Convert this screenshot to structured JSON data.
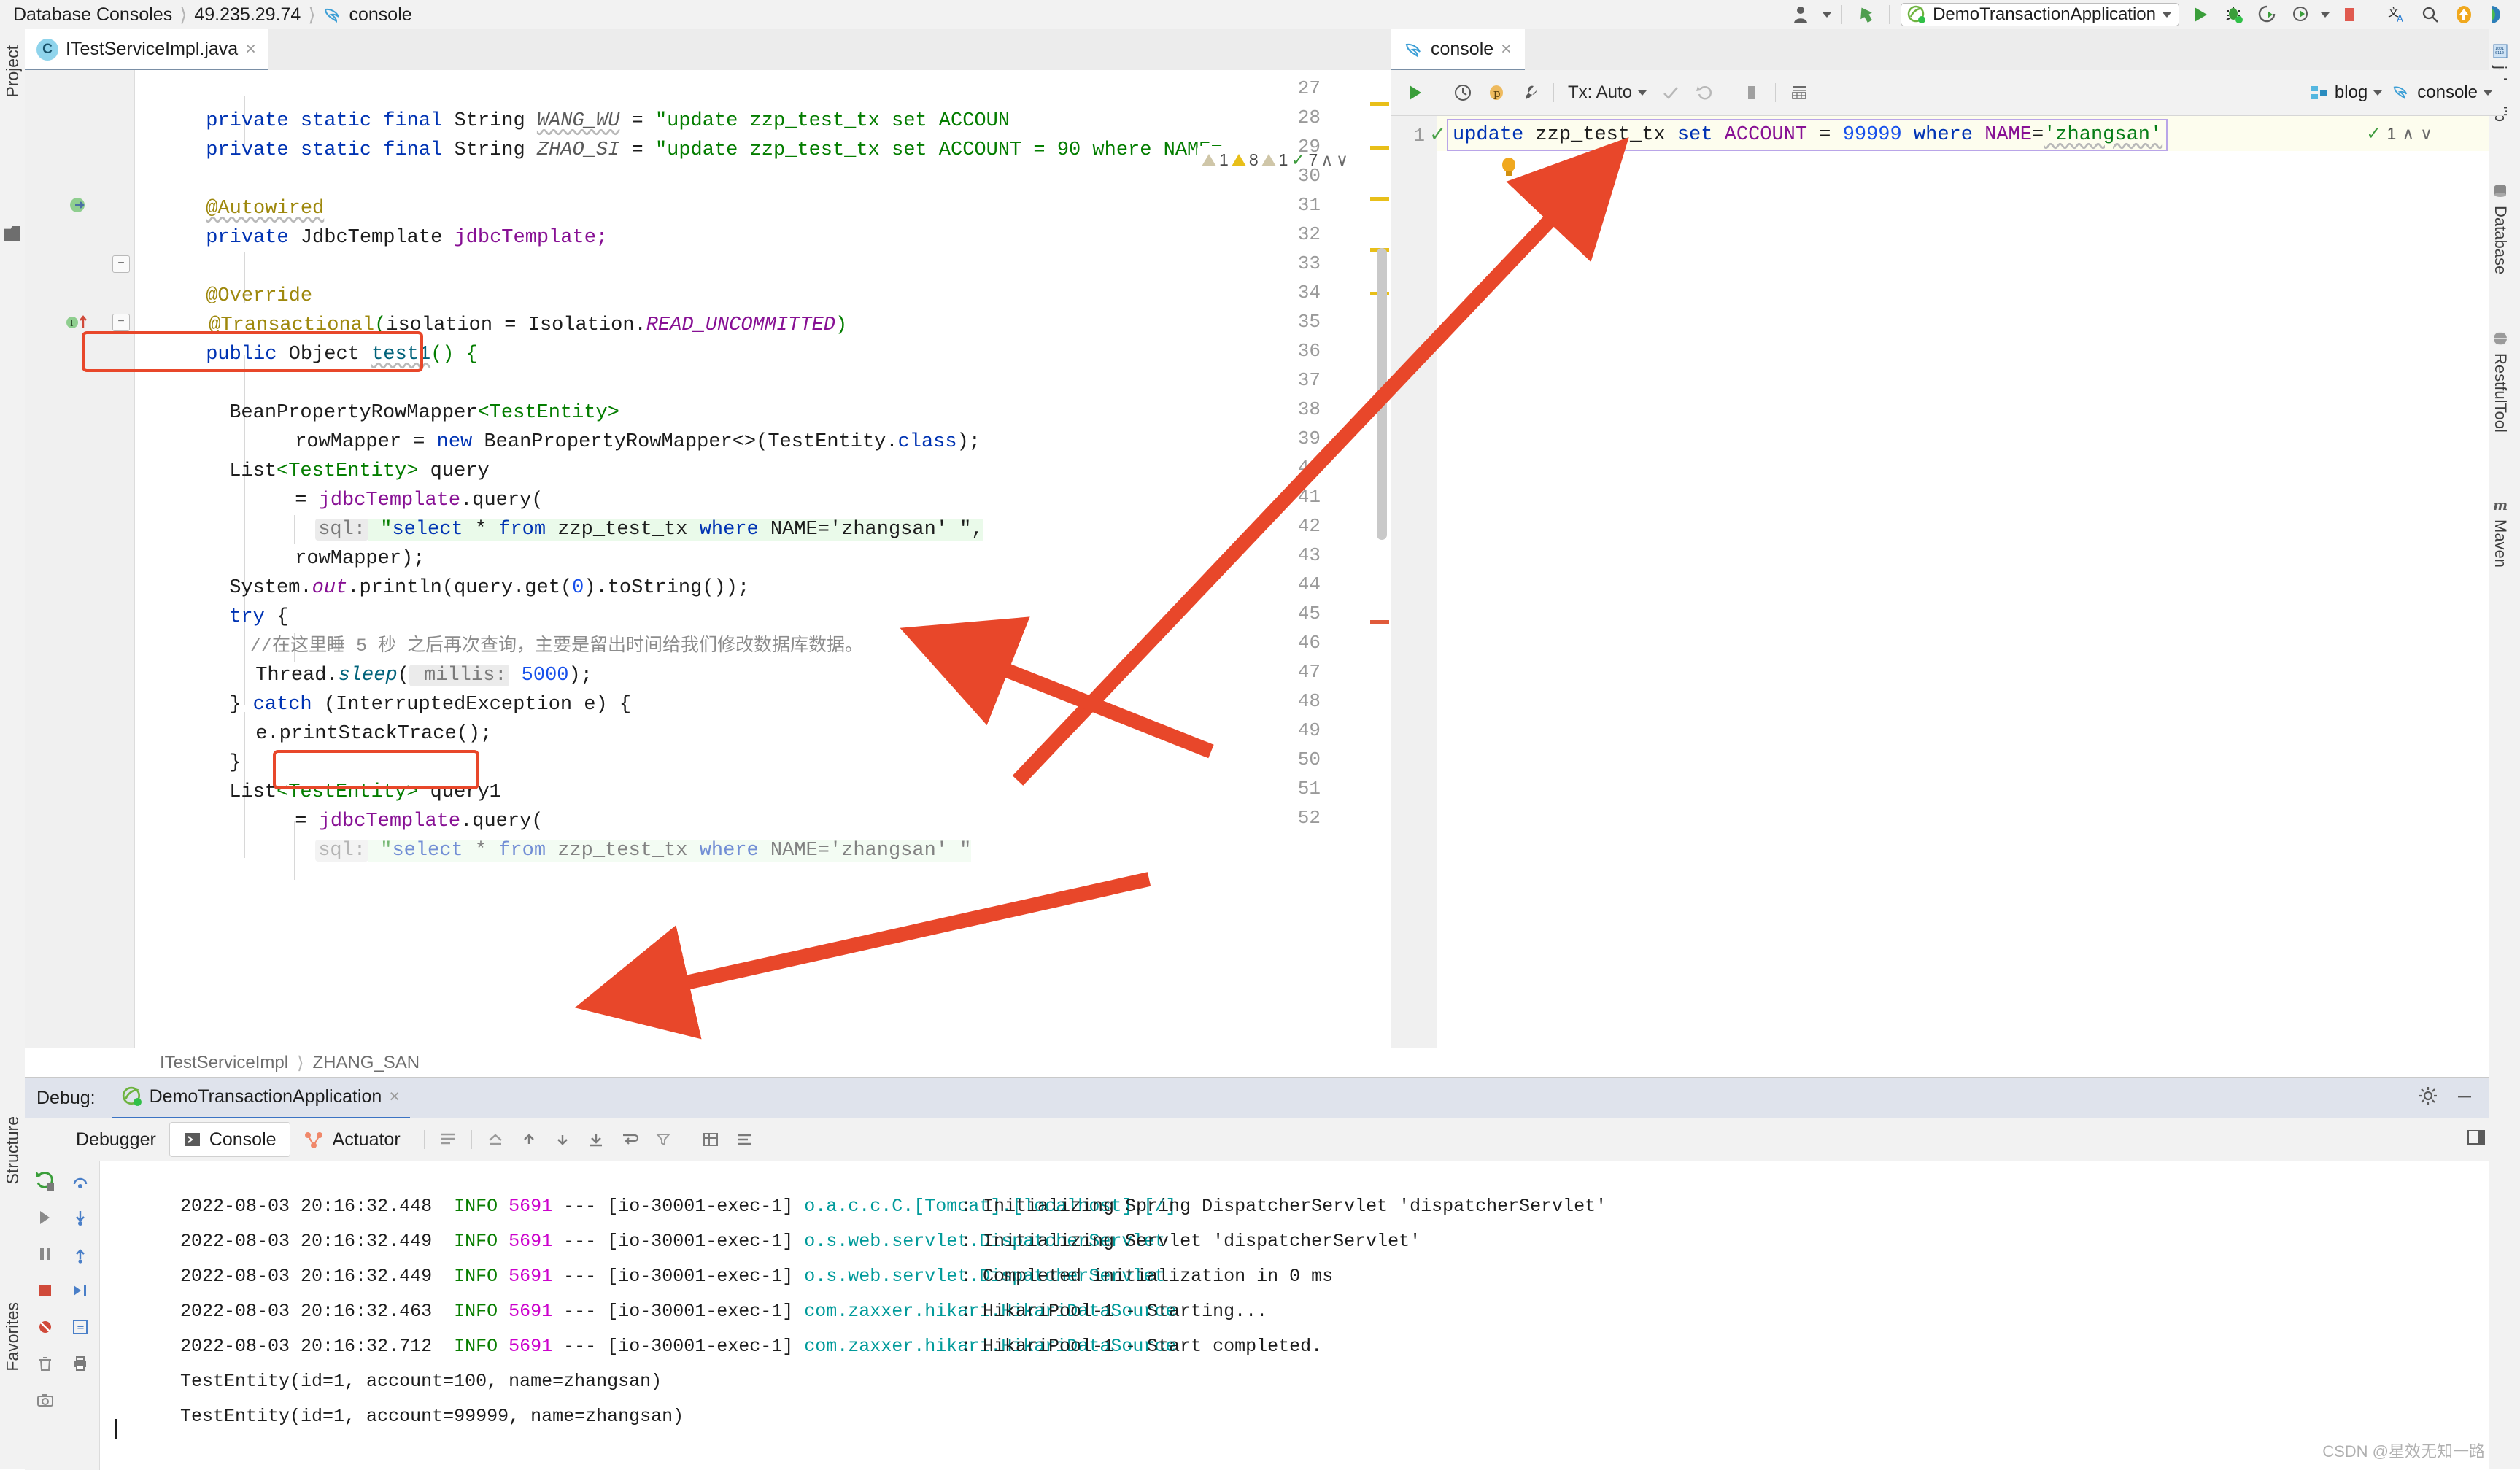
{
  "topbar": {
    "breadcrumbs": [
      "Database Consoles",
      "49.235.29.74",
      "console"
    ],
    "db_icon": "dolphin-icon",
    "right_icons": [
      "user-icon",
      "chevron-down-icon",
      "vcs-update-icon"
    ],
    "run_config": {
      "name": "DemoTransactionApplication",
      "icon": "spring-boot-icon"
    },
    "action_icons": [
      "run-icon",
      "debug-icon",
      "run-with-coverage-icon",
      "profile-icon",
      "stop-icon",
      "translate-icon",
      "search-everywhere-icon",
      "update-icon",
      "theme-icon"
    ]
  },
  "left_strip": {
    "project_label": "Project",
    "structure_label": "Structure",
    "favorites_label": "Favorites",
    "folder_icon": "folder-icon"
  },
  "right_strip": {
    "items": [
      {
        "label": "jclasslib",
        "icon": "jclasslib-icon"
      },
      {
        "label": "Database",
        "icon": "database-icon"
      },
      {
        "label": "RestfulTool",
        "icon": "globe-icon"
      },
      {
        "label": "Maven",
        "icon": "maven-icon"
      }
    ]
  },
  "editor": {
    "tab": {
      "label": "ITestServiceImpl.java",
      "badge": "C",
      "close": "×"
    },
    "inspections": {
      "weak_warning": "1",
      "warning": "8",
      "typo": "1",
      "ok": "7",
      "up": "∧",
      "down": "∨"
    },
    "breadcrumb": [
      "ITestServiceImpl",
      "ZHANG_SAN"
    ],
    "lines": [
      {
        "no": "27",
        "code": "    private static final String WANG_WU = \"update zzp_test_tx set ACCOUNT"
      },
      {
        "no": "28",
        "code": "    private static final String ZHAO_SI = \"update zzp_test_tx set ACCOUNT = 90 where NAME="
      },
      {
        "no": "29",
        "code": ""
      },
      {
        "no": "30",
        "code": "    @Autowired"
      },
      {
        "no": "31",
        "code": "    private JdbcTemplate jdbcTemplate;"
      },
      {
        "no": "32",
        "code": ""
      },
      {
        "no": "33",
        "code": "    @Override"
      },
      {
        "no": "34",
        "code": "    @Transactional(isolation = Isolation.READ_UNCOMMITTED)"
      },
      {
        "no": "35",
        "code": "    public Object test1() {"
      },
      {
        "no": "36",
        "code": ""
      },
      {
        "no": "37",
        "code": "        BeanPropertyRowMapper<TestEntity>"
      },
      {
        "no": "38",
        "code": "                rowMapper = new BeanPropertyRowMapper<>(TestEntity.class);"
      },
      {
        "no": "39",
        "code": "        List<TestEntity> query"
      },
      {
        "no": "40",
        "code": "                = jdbcTemplate.query("
      },
      {
        "no": "41",
        "code": "                sql: \"select * from zzp_test_tx where NAME='zhangsan' \","
      },
      {
        "no": "42",
        "code": "                rowMapper);"
      },
      {
        "no": "43",
        "code": "        System.out.println(query.get(0).toString());"
      },
      {
        "no": "44",
        "code": "        try {"
      },
      {
        "no": "45",
        "code": "            //在这里睡 5 秒 之后再次查询，主要是留出时间给我们修改数据库数据。"
      },
      {
        "no": "46",
        "code": "            Thread.sleep( millis: 5000);"
      },
      {
        "no": "47",
        "code": "        } catch (InterruptedException e) {"
      },
      {
        "no": "48",
        "code": "            e.printStackTrace();"
      },
      {
        "no": "49",
        "code": "        }"
      },
      {
        "no": "50",
        "code": "        List<TestEntity> query1"
      },
      {
        "no": "51",
        "code": "                = jdbcTemplate.query("
      },
      {
        "no": "52",
        "code": "                sql: \"select * from zzp_test_tx where NAME='zhangsan' \""
      }
    ],
    "tokens": {
      "l27": {
        "mod": "private static final",
        "type": "String",
        "name": "WANG_WU",
        "eq": "=",
        "str": "\"update zzp_test_tx set ACCOUN"
      },
      "l28": {
        "mod": "private static final",
        "type": "String",
        "name": "ZHAO_SI",
        "eq": "=",
        "str": "\"update zzp_test_tx set ACCOUNT = 90 where NAME="
      },
      "l30": {
        "ann": "@Autowired"
      },
      "l31": {
        "mod": "private",
        "type": "JdbcTemplate",
        "name": "jdbcTemplate;"
      },
      "l33": {
        "ann": "@Override"
      },
      "l34": {
        "ann": "@Transactional",
        "open": "(",
        "param": "isolation = Isolation.",
        "const": "READ_UNCOMMITTED",
        "close": ")"
      },
      "l35": {
        "mod": "public",
        "type": "Object",
        "name": "test1",
        "sig": "() {"
      },
      "l37": {
        "type": "BeanPropertyRowMapper",
        "gen": "<TestEntity>"
      },
      "l38": {
        "name": "rowMapper = ",
        "kw": "new",
        "rest": " BeanPropertyRowMapper<>(TestEntity.",
        "cls": "class",
        "tail": ");"
      },
      "l39": {
        "type": "List",
        "gen": "<TestEntity>",
        "name": " query"
      },
      "l40": {
        "eq": "= ",
        "obj": "jdbcTemplate",
        "dot": ".query("
      },
      "l41": {
        "hint": "sql:",
        "str1": "\"select",
        "star": " * ",
        "from": "from",
        "tbl": " zzp_test_tx ",
        "where": "where",
        "rest": " NAME='zhangsan' \","
      },
      "l42": {
        "txt": "rowMapper);"
      },
      "l43": {
        "sys": "System.",
        "out": "out",
        "rest": ".println(query.get(",
        "zero": "0",
        "tail": ").toString());"
      },
      "l44": {
        "kw": "try",
        "brace": " {"
      },
      "l45": {
        "comment": "//在这里睡 5 秒 之后再次查询，主要是留出时间给我们修改数据库数据。"
      },
      "l46": {
        "cls": "Thread.",
        "mth": "sleep",
        "hint": " millis:",
        "num": " 5000",
        "tail": ");"
      },
      "l47": {
        "close": "} ",
        "kw": "catch",
        "rest": " (InterruptedException e) {"
      },
      "l48": {
        "txt": "e.printStackTrace();"
      },
      "l49": {
        "txt": "}"
      },
      "l50": {
        "type": "List",
        "gen": "<TestEntity>",
        "name": " query1"
      },
      "l51": {
        "eq": "= ",
        "obj": "jdbcTemplate",
        "dot": ".query("
      },
      "l52": {
        "hint": "sql:",
        "str1": "\"select",
        "star": " * ",
        "from": "from",
        "tbl": " zzp_test_tx ",
        "where": "where",
        "rest": " NAME='zhangsan' \""
      }
    }
  },
  "sql_console": {
    "tab": {
      "label": "console",
      "icon": "dolphin-icon",
      "close": "×"
    },
    "toolbar": {
      "execute": "run-icon",
      "history": "history-icon",
      "params": "p",
      "wrench": "wrench-icon",
      "tx_label": "Tx: Auto",
      "commit": "commit-icon",
      "rollback": "rollback-icon",
      "stop": "stop-icon",
      "table_icon": "table-icon",
      "schema": "blog",
      "console_select": "console"
    },
    "statement": {
      "line_no": "1",
      "status": "✓",
      "kw_update": "update",
      "table": " zzp_test_tx ",
      "kw_set": "set",
      "column": " ACCOUNT ",
      "eq": "= ",
      "value": "99999",
      "kw_where": " where",
      "col2": " NAME",
      "eq2": "=",
      "str": "'zhangsan'"
    },
    "right_inspection": {
      "ok": "1",
      "up": "∧",
      "down": "∨"
    }
  },
  "debug_panel": {
    "lead_label": "Debug:",
    "tab": {
      "label": "DemoTransactionApplication",
      "icon": "spring-boot-icon",
      "close": "×"
    },
    "tabs": [
      {
        "label": "Debugger",
        "icon": "debugger-icon",
        "active": false
      },
      {
        "label": "Console",
        "icon": "console-icon",
        "active": true
      },
      {
        "label": "Actuator",
        "icon": "actuator-icon",
        "active": false
      }
    ],
    "rail_icons": [
      "rerun-icon",
      "resume-icon",
      "step-over-icon",
      "step-into-icon",
      "step-out-icon",
      "pause-icon",
      "stop-icon",
      "print-icon",
      "trash-icon",
      "camera-icon"
    ],
    "log": [
      {
        "ts": "2022-08-03 20:16:32.448",
        "level": "INFO",
        "pid": "5691",
        "dash": "---",
        "thread": "[io-30001-exec-1]",
        "logger": "o.a.c.c.C.[Tomcat].[localhost].[/]",
        "msg": ": Initializing Spring DispatcherServlet 'dispatcherServlet'"
      },
      {
        "ts": "2022-08-03 20:16:32.449",
        "level": "INFO",
        "pid": "5691",
        "dash": "---",
        "thread": "[io-30001-exec-1]",
        "logger": "o.s.web.servlet.DispatcherServlet",
        "msg": ": Initializing Servlet 'dispatcherServlet'"
      },
      {
        "ts": "2022-08-03 20:16:32.449",
        "level": "INFO",
        "pid": "5691",
        "dash": "---",
        "thread": "[io-30001-exec-1]",
        "logger": "o.s.web.servlet.DispatcherServlet",
        "msg": ": Completed initialization in 0 ms"
      },
      {
        "ts": "2022-08-03 20:16:32.463",
        "level": "INFO",
        "pid": "5691",
        "dash": "---",
        "thread": "[io-30001-exec-1]",
        "logger": "com.zaxxer.hikari.HikariDataSource",
        "msg": ": HikariPool-1 - Starting..."
      },
      {
        "ts": "2022-08-03 20:16:32.712",
        "level": "INFO",
        "pid": "5691",
        "dash": "---",
        "thread": "[io-30001-exec-1]",
        "logger": "com.zaxxer.hikari.HikariDataSource",
        "msg": ": HikariPool-1 - Start completed."
      }
    ],
    "plain_output": [
      "TestEntity(id=1, account=100, name=zhangsan)",
      "TestEntity(id=1, account=99999, name=zhangsan)"
    ]
  },
  "watermark": "CSDN @星效无知一路",
  "colors": {
    "annotation_red": "#e8472a",
    "arrow_red": "#e8472a",
    "keyword_blue": "#0033b3",
    "string_green": "#047d00",
    "field_purple": "#871094",
    "logger_teal": "#009a9a",
    "info_green": "#087d00",
    "pid_magenta": "#cc00cc",
    "tab_underline": "#7a8fa6",
    "debug_underline": "#3b73c4"
  }
}
